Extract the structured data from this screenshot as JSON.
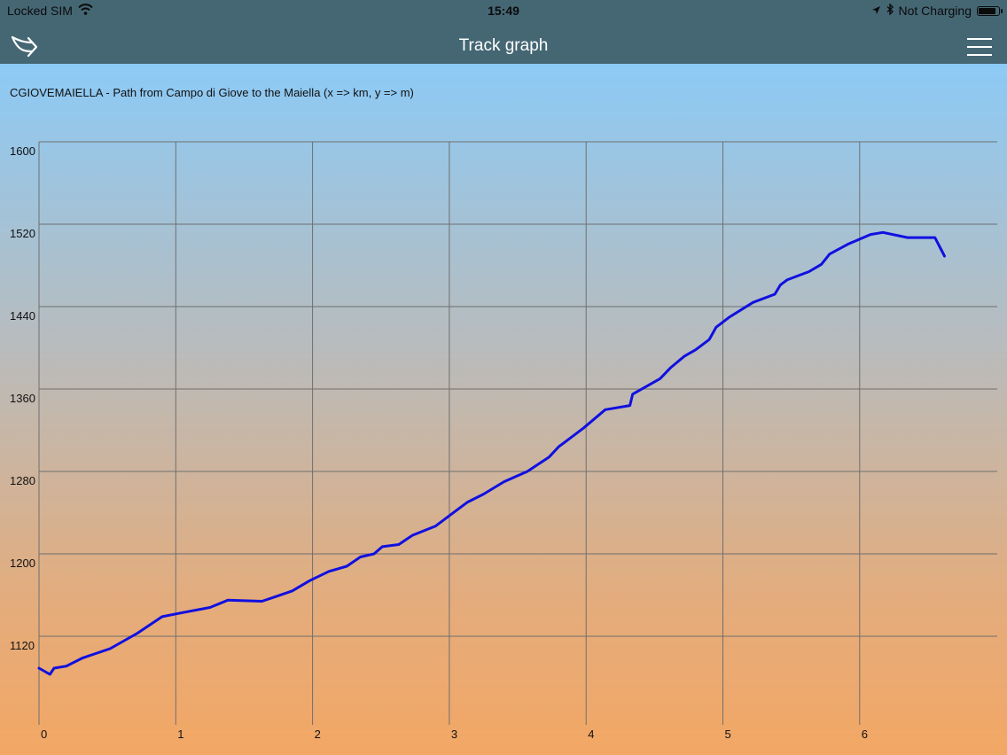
{
  "status_bar": {
    "carrier": "Locked SIM",
    "time": "15:49",
    "charging": "Not Charging",
    "battery_level": 0.9
  },
  "nav": {
    "title": "Track graph",
    "back_icon": "share-arrow-icon",
    "menu_icon": "hamburger-menu-icon"
  },
  "colors": {
    "bar": "#456774",
    "line": "#1010e0",
    "grid": "#6f6f6f"
  },
  "chart_data": {
    "type": "line",
    "title": "CGIOVEMAIELLA - Path from Campo di Giove to the Maiella (x => km, y => m)",
    "xlim": [
      0,
      7
    ],
    "ylim": [
      1080,
      1600
    ],
    "x_ticks": [
      0,
      1,
      2,
      3,
      4,
      5,
      6
    ],
    "y_ticks": [
      1120,
      1200,
      1280,
      1360,
      1440,
      1520,
      1600
    ],
    "x_tick_labels": [
      "0",
      "1",
      "2",
      "3",
      "4",
      "5",
      "6"
    ],
    "y_tick_labels": [
      "1120",
      "1200",
      "1280",
      "1360",
      "1440",
      "1520",
      "1600"
    ],
    "grid": true,
    "series": [
      {
        "x": [
          0,
          0.08,
          0.11,
          0.2,
          0.32,
          0.52,
          0.72,
          0.9,
          1.05,
          1.25,
          1.38,
          1.63,
          1.72,
          1.85,
          1.98,
          2.12,
          2.25,
          2.35,
          2.45,
          2.51,
          2.63,
          2.73,
          2.9,
          2.98,
          3.13,
          3.25,
          3.4,
          3.57,
          3.73,
          3.8,
          3.98,
          4.14,
          4.32,
          4.34,
          4.54,
          4.62,
          4.72,
          4.8,
          4.9,
          4.95,
          5.05,
          5.22,
          5.38,
          5.42,
          5.47,
          5.63,
          5.72,
          5.78,
          5.92,
          6.08,
          6.17,
          6.35,
          6.55,
          6.62
        ],
        "y": [
          1089,
          1083,
          1089,
          1091,
          1099,
          1108,
          1123,
          1139,
          1143,
          1148,
          1155,
          1154,
          1158,
          1164,
          1174,
          1183,
          1188,
          1197,
          1200,
          1207,
          1209,
          1218,
          1227,
          1235,
          1250,
          1258,
          1270,
          1280,
          1294,
          1304,
          1322,
          1340,
          1344,
          1355,
          1370,
          1381,
          1392,
          1398,
          1408,
          1420,
          1430,
          1444,
          1452,
          1461,
          1466,
          1474,
          1481,
          1491,
          1501,
          1510,
          1512,
          1507,
          1507,
          1489
        ]
      }
    ]
  }
}
